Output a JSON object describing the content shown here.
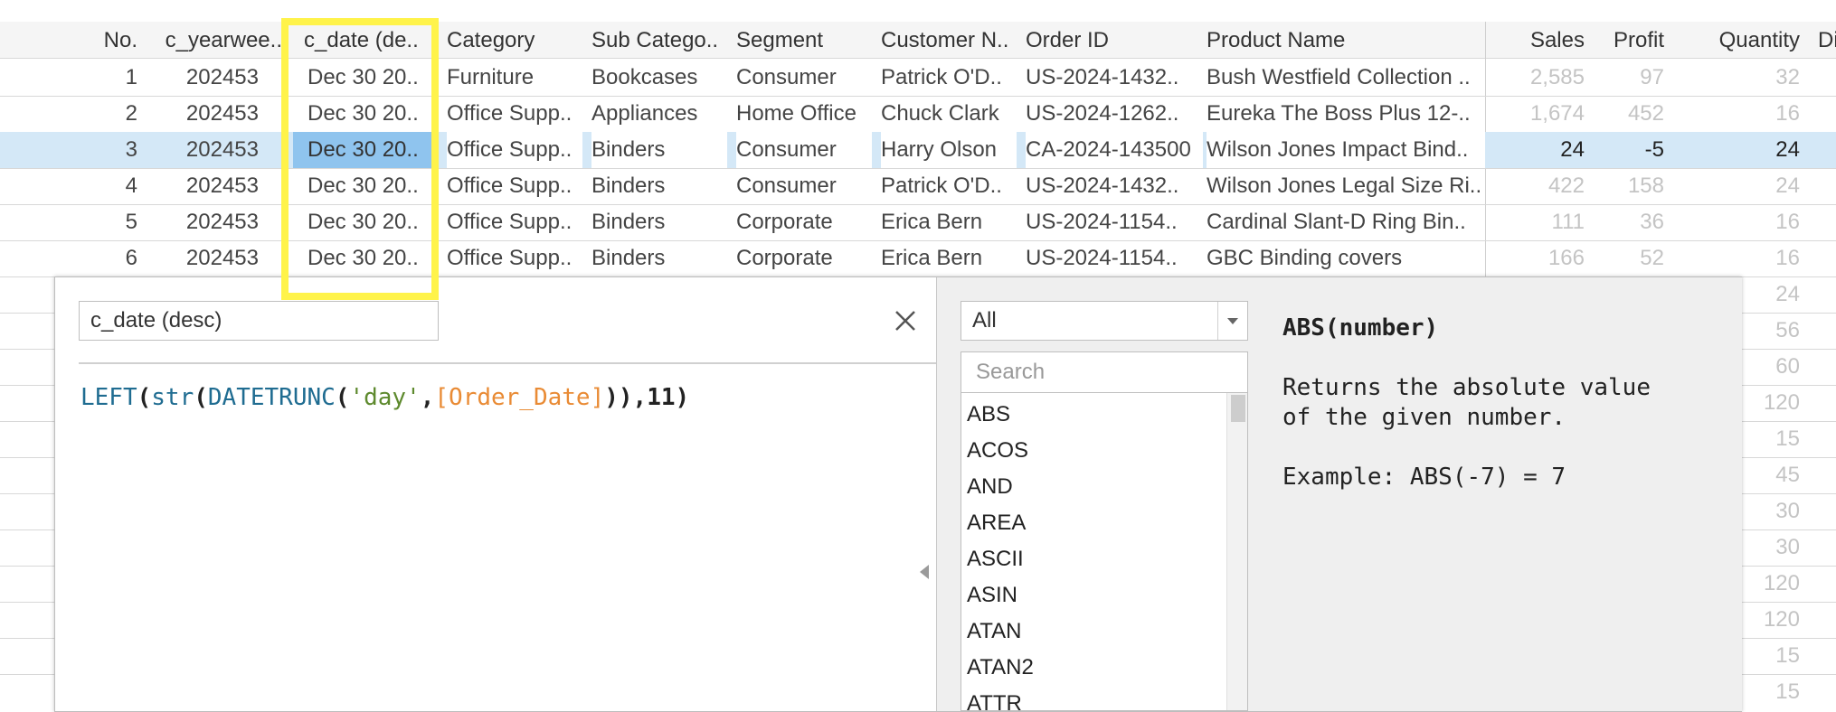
{
  "table": {
    "columns": [
      {
        "label": "No.",
        "key": "no"
      },
      {
        "label": "c_yearwee..",
        "key": "yearweek"
      },
      {
        "label": "c_date (de..",
        "key": "date"
      },
      {
        "label": "Category",
        "key": "category"
      },
      {
        "label": "Sub Catego..",
        "key": "subcategory"
      },
      {
        "label": "Segment",
        "key": "segment"
      },
      {
        "label": "Customer N..",
        "key": "customer"
      },
      {
        "label": "Order ID",
        "key": "order"
      },
      {
        "label": "Product Name",
        "key": "product"
      },
      {
        "label": "Sales",
        "key": "sales"
      },
      {
        "label": "Profit",
        "key": "profit"
      },
      {
        "label": "Quantity",
        "key": "quantity"
      },
      {
        "label": "Di",
        "key": "discount"
      }
    ],
    "selected_row": 3,
    "rows": [
      {
        "no": "1",
        "yearweek": "202453",
        "date": "Dec 30 20..",
        "category": "Furniture",
        "subcategory": "Bookcases",
        "segment": "Consumer",
        "customer": "Patrick O'D..",
        "order": "US-2024-1432..",
        "product": "Bush Westfield Collection ..",
        "sales": "2,585",
        "profit": "97",
        "quantity": "32"
      },
      {
        "no": "2",
        "yearweek": "202453",
        "date": "Dec 30 20..",
        "category": "Office Supp..",
        "subcategory": "Appliances",
        "segment": "Home Office",
        "customer": "Chuck Clark",
        "order": "US-2024-1262..",
        "product": "Eureka The Boss Plus 12-..",
        "sales": "1,674",
        "profit": "452",
        "quantity": "16"
      },
      {
        "no": "3",
        "yearweek": "202453",
        "date": "Dec 30 20..",
        "category": "Office Supp..",
        "subcategory": "Binders",
        "segment": "Consumer",
        "customer": "Harry Olson",
        "order": "CA-2024-143500",
        "product": "Wilson Jones Impact Bind..",
        "sales": "24",
        "profit": "-5",
        "quantity": "24"
      },
      {
        "no": "4",
        "yearweek": "202453",
        "date": "Dec 30 20..",
        "category": "Office Supp..",
        "subcategory": "Binders",
        "segment": "Consumer",
        "customer": "Patrick O'D..",
        "order": "US-2024-1432..",
        "product": "Wilson Jones Legal Size Ri..",
        "sales": "422",
        "profit": "158",
        "quantity": "24"
      },
      {
        "no": "5",
        "yearweek": "202453",
        "date": "Dec 30 20..",
        "category": "Office Supp..",
        "subcategory": "Binders",
        "segment": "Corporate",
        "customer": "Erica Bern",
        "order": "US-2024-1154..",
        "product": "Cardinal Slant-D Ring Bin..",
        "sales": "111",
        "profit": "36",
        "quantity": "16"
      },
      {
        "no": "6",
        "yearweek": "202453",
        "date": "Dec 30 20..",
        "category": "Office Supp..",
        "subcategory": "Binders",
        "segment": "Corporate",
        "customer": "Erica Bern",
        "order": "US-2024-1154..",
        "product": "GBC Binding covers",
        "sales": "166",
        "profit": "52",
        "quantity": "16"
      }
    ],
    "hidden_quantities": [
      "24",
      "56",
      "60",
      "120",
      "15",
      "45",
      "30",
      "30",
      "120",
      "120",
      "15",
      "15"
    ]
  },
  "calc_dialog": {
    "name_value": "c_date (desc)",
    "formula": {
      "fn1": "LEFT",
      "p1": "(",
      "fn2": "str",
      "p2": "(",
      "fn3": "DATETRUNC",
      "p3": "(",
      "str": "'day'",
      "comma1": ",",
      "field": "[Order_Date]",
      "p4": "))",
      "comma2": ",",
      "num": "11",
      "p5": ")"
    },
    "category_dropdown": "All",
    "search_placeholder": "Search",
    "functions": [
      "ABS",
      "ACOS",
      "AND",
      "AREA",
      "ASCII",
      "ASIN",
      "ATAN",
      "ATAN2",
      "ATTR"
    ],
    "help": {
      "signature": "ABS(number)",
      "description_line1": "Returns the absolute value",
      "description_line2": "of the given number.",
      "example": "Example: ABS(-7) = 7"
    }
  },
  "colors": {
    "highlight": "#fff34a",
    "selected_row": "#d4e8f7",
    "selected_cell": "#8fc4ee",
    "function": "#1f6c91",
    "string": "#5e8a2e",
    "field": "#e98b35"
  }
}
